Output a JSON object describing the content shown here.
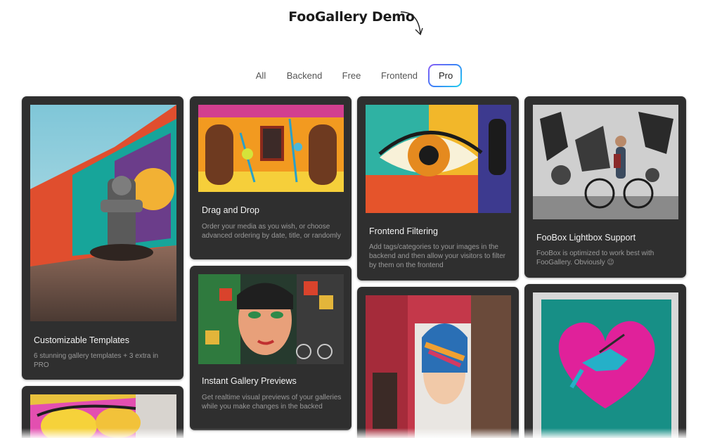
{
  "title": "FooGallery Demo",
  "filters": {
    "all": "All",
    "backend": "Backend",
    "free": "Free",
    "frontend": "Frontend",
    "pro": "Pro",
    "active": "Pro"
  },
  "cards": {
    "templates": {
      "title": "Customizable Templates",
      "desc": "6 stunning gallery templates + 3 extra in PRO"
    },
    "drag": {
      "title": "Drag and Drop",
      "desc": "Order your media as you wish, or choose advanced ordering by date, title, or randomly"
    },
    "filtering": {
      "title": "Frontend Filtering",
      "desc": "Add tags/categories to your images in the backend and then allow your visitors to filter by them on the frontend"
    },
    "foobox": {
      "title": "FooBox Lightbox Support",
      "desc": "FooBox is optimized to work best with FooGallery. Obviously 😉"
    },
    "previews": {
      "title": "Instant Gallery Previews",
      "desc": "Get realtime visual previews of your galleries while you make changes in the backed"
    }
  },
  "colors": {
    "card_bg": "#2f2f2f",
    "active_gradient": [
      "#8b5cf6",
      "#3b82f6",
      "#22d3ee"
    ]
  }
}
